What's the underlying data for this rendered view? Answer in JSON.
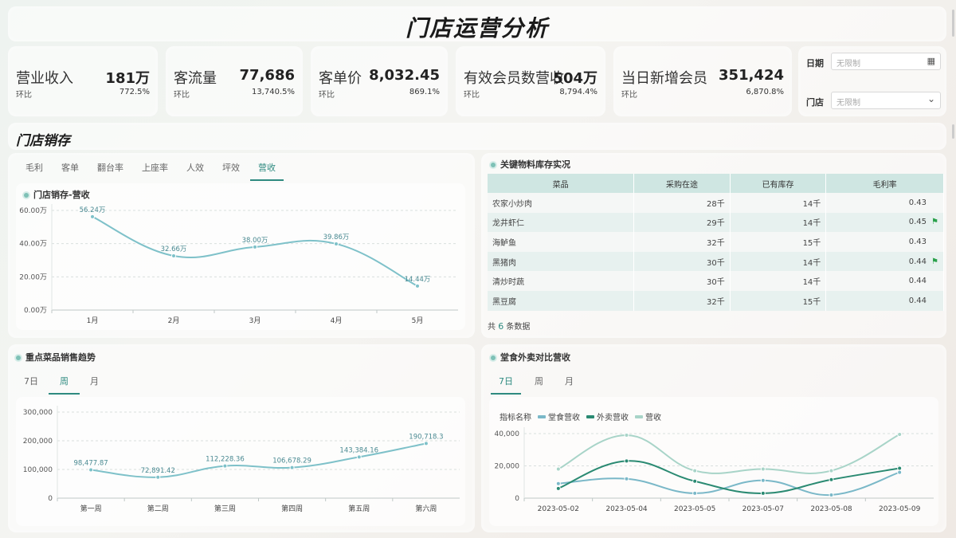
{
  "page_title": "门店运营分析",
  "kpis": [
    {
      "label": "营业收入",
      "value": "181万",
      "sub_label": "环比",
      "pct": "772.5%"
    },
    {
      "label": "客流量",
      "value": "77,686",
      "sub_label": "环比",
      "pct": "13,740.5%"
    },
    {
      "label": "客单价",
      "value": "8,032.45",
      "sub_label": "环比",
      "pct": "869.1%"
    },
    {
      "label": "有效会员数营收",
      "value": "504万",
      "sub_label": "环比",
      "pct": "8,794.4%"
    },
    {
      "label": "当日新增会员",
      "value": "351,424",
      "sub_label": "环比",
      "pct": "6,870.8%"
    }
  ],
  "filters": {
    "date_label": "日期",
    "date_placeholder": "无限制",
    "store_label": "门店",
    "store_placeholder": "无限制"
  },
  "section_title": "门店销存",
  "store_tabs": [
    "毛利",
    "客单",
    "翻台率",
    "上座率",
    "人效",
    "坪效",
    "营收"
  ],
  "store_tab_active": 6,
  "store_chart_title": "门店销存-营收",
  "inventory": {
    "title": "关键物料库存实况",
    "headers": [
      "菜品",
      "采购在途",
      "已有库存",
      "毛利率"
    ],
    "rows": [
      {
        "name": "农家小炒肉",
        "transit": "28千",
        "stock": "14千",
        "margin": "0.43",
        "flag": false
      },
      {
        "name": "龙井虾仁",
        "transit": "29千",
        "stock": "14千",
        "margin": "0.45",
        "flag": true
      },
      {
        "name": "海鲈鱼",
        "transit": "32千",
        "stock": "15千",
        "margin": "0.43",
        "flag": false
      },
      {
        "name": "黑猪肉",
        "transit": "30千",
        "stock": "14千",
        "margin": "0.44",
        "flag": true
      },
      {
        "name": "清炒时蔬",
        "transit": "30千",
        "stock": "14千",
        "margin": "0.44",
        "flag": false
      },
      {
        "name": "黑豆腐",
        "transit": "32千",
        "stock": "15千",
        "margin": "0.44",
        "flag": false
      }
    ],
    "total_prefix": "共",
    "total_count": "6",
    "total_suffix": "条数据"
  },
  "dish_trend": {
    "title": "重点菜品销售趋势",
    "tabs": [
      "7日",
      "周",
      "月"
    ],
    "active_tab": 1
  },
  "dine_vs_delivery": {
    "title": "堂食外卖对比营收",
    "tabs": [
      "7日",
      "周",
      "月"
    ],
    "active_tab": 0,
    "legend_prefix": "指标名称"
  },
  "colors": {
    "line_main": "#7ec1c9",
    "dine": "#7ab8c8",
    "delivery": "#2a8a72",
    "revenue": "#a8d4c8",
    "accent": "#2e8a80"
  },
  "chart_data": [
    {
      "type": "line",
      "title": "门店销存-营收",
      "categories": [
        "1月",
        "2月",
        "3月",
        "4月",
        "5月"
      ],
      "values": [
        56.24,
        32.66,
        38.0,
        39.86,
        14.44
      ],
      "value_labels": [
        "56.24万",
        "32.66万",
        "38.00万",
        "39.86万",
        "14.44万"
      ],
      "yticks": [
        "0.00万",
        "20.00万",
        "40.00万",
        "60.00万"
      ],
      "ylim": [
        0,
        60
      ]
    },
    {
      "type": "line",
      "title": "重点菜品销售趋势",
      "categories": [
        "第一周",
        "第二周",
        "第三周",
        "第四周",
        "第五周",
        "第六周"
      ],
      "values": [
        98477.87,
        72891.42,
        112228.36,
        106678.29,
        143384.16,
        190718.3
      ],
      "value_labels": [
        "98,477.87",
        "72,891.42",
        "112,228.36",
        "106,678.29",
        "143,384.16",
        "190,718.3"
      ],
      "yticks": [
        "0",
        "100,000",
        "200,000",
        "300,000"
      ],
      "ylim": [
        0,
        300000
      ]
    },
    {
      "type": "line",
      "title": "堂食外卖对比营收",
      "categories": [
        "2023-05-02",
        "2023-05-04",
        "2023-05-05",
        "2023-05-07",
        "2023-05-08",
        "2023-05-09"
      ],
      "yticks": [
        "0",
        "20,000",
        "40,000"
      ],
      "ylim": [
        0,
        40000
      ],
      "series": [
        {
          "name": "堂食营收",
          "values": [
            9000,
            12000,
            3000,
            11000,
            2000,
            16000
          ]
        },
        {
          "name": "外卖营收",
          "values": [
            6000,
            23000,
            10500,
            3000,
            11500,
            18500
          ]
        },
        {
          "name": "营收",
          "values": [
            18000,
            39000,
            17000,
            18000,
            17000,
            39500
          ]
        }
      ]
    }
  ]
}
